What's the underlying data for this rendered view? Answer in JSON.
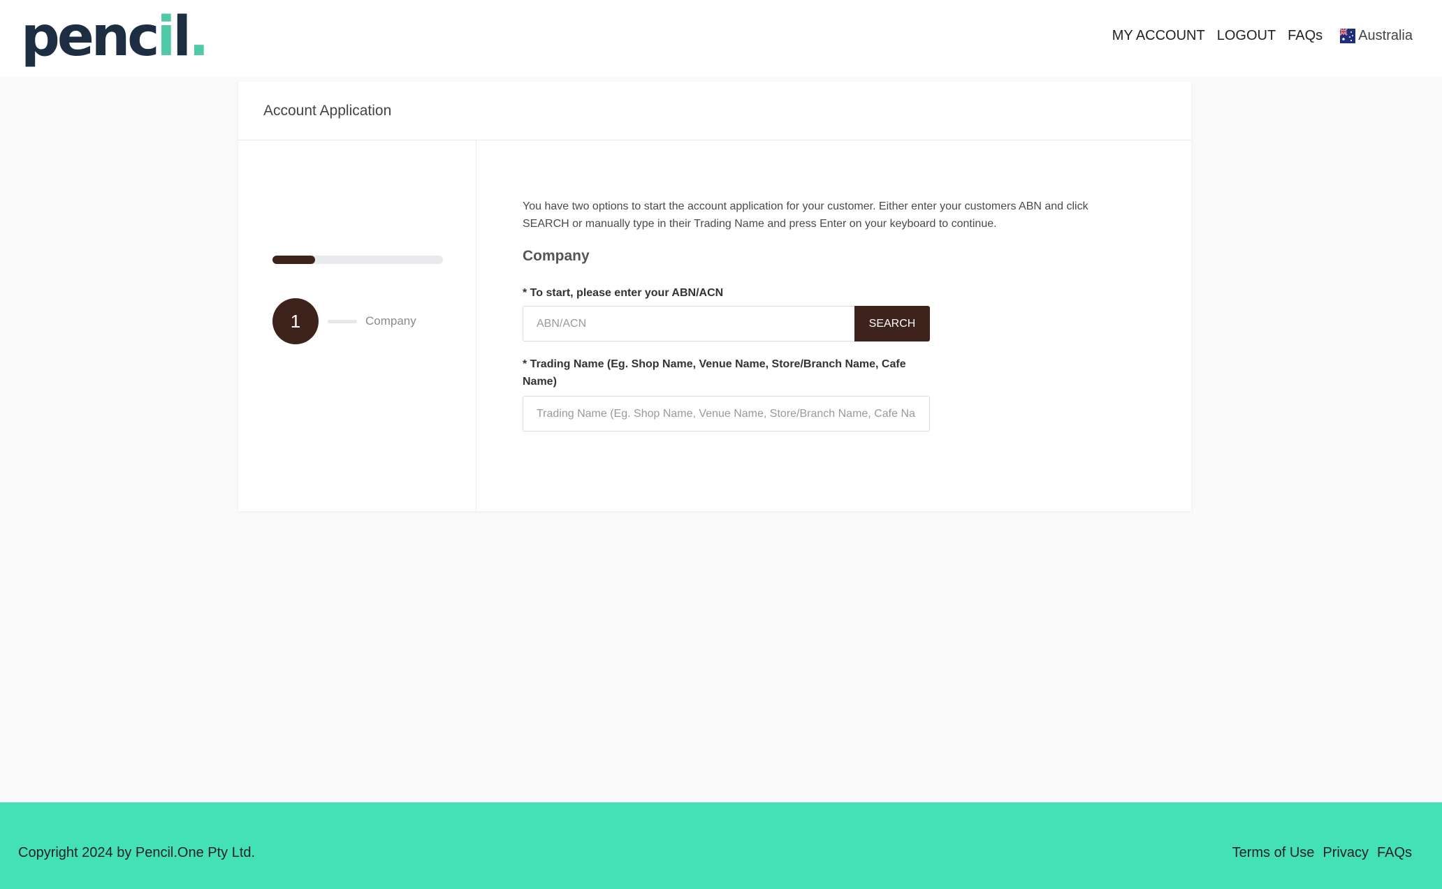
{
  "header": {
    "logo": {
      "text_main": "penc",
      "text_i": "i",
      "text_end": "l",
      "dot": ".",
      "accent_color": "#4fc9a6",
      "color": "#1d2e42"
    },
    "nav": {
      "my_account": "MY ACCOUNT",
      "logout": "LOGOUT",
      "faqs": "FAQs",
      "country": "Australia",
      "country_icon": "australia-flag-icon"
    }
  },
  "card": {
    "title": "Account Application",
    "progress": {
      "fraction": 0.25,
      "color": "#3d231b"
    },
    "steps": [
      {
        "number": "1",
        "label": "Company"
      }
    ],
    "form": {
      "intro": "You have two options to start the account application for your customer. Either enter your customers ABN and click SEARCH or manually type in their Trading Name and press Enter on your keyboard to continue.",
      "section_title": "Company",
      "abn_label": "* To start, please enter your ABN/ACN",
      "abn_placeholder": "ABN/ACN",
      "abn_value": "",
      "search_button": "SEARCH",
      "trading_label": "* Trading Name (Eg. Shop Name, Venue Name, Store/Branch Name, Cafe Name)",
      "trading_placeholder": "Trading Name (Eg. Shop Name, Venue Name, Store/Branch Name, Cafe Name)",
      "trading_value": ""
    }
  },
  "footer": {
    "copyright": "Copyright 2024 by Pencil.One Pty Ltd.",
    "links": {
      "terms": "Terms of Use",
      "privacy": "Privacy",
      "faqs": "FAQs"
    },
    "background": "#44e0b6"
  }
}
